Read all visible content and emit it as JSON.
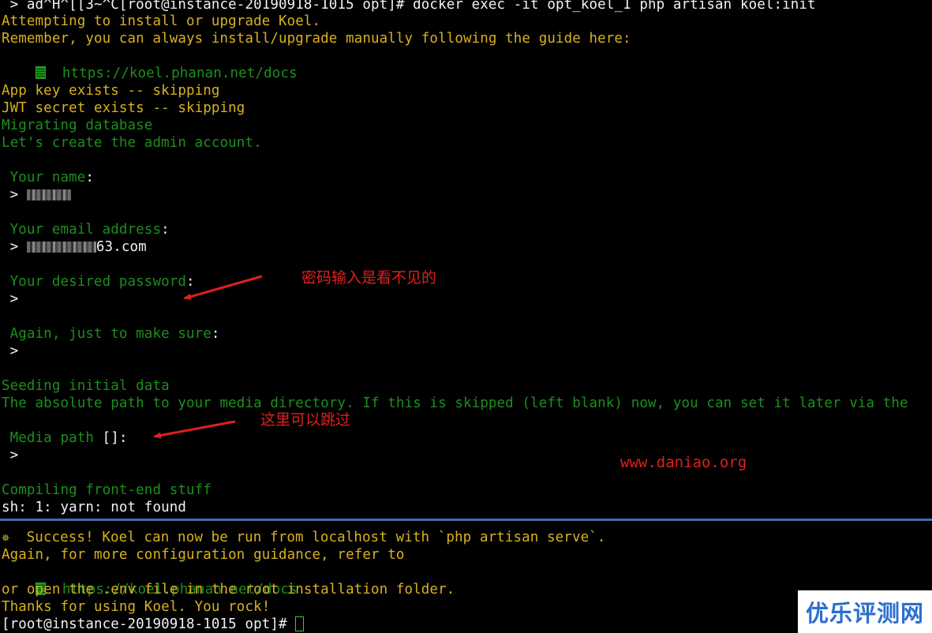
{
  "terminal": {
    "lines": {
      "cmd": " > ad^H^[[3~^C[root@instance-20190918-1015 opt]# docker exec -it opt_koel_1 php artisan koel:init",
      "attempting": "Attempting to install or upgrade Koel.",
      "remember": "Remember, you can always install/upgrade manually following the guide here:",
      "docs1": "  https://koel.phanan.net/docs",
      "appkey": "App key exists -- skipping",
      "jwt": "JWT secret exists -- skipping",
      "migrating": "Migrating database",
      "create_admin": "Let's create the admin account.",
      "name_prompt": " Your name",
      "colon": ":",
      "prompt_char": " > ",
      "email_prompt": " Your email address",
      "email_suffix": "63.com",
      "password_prompt": " Your desired password",
      "again_prompt": " Again, just to make sure",
      "seeding": "Seeding initial data",
      "absolute": "The absolute path to your media directory. If this is skipped (left blank) now, you can set it later via the",
      "media_prompt": " Media path ",
      "media_default": "[]:",
      "compiling": "Compiling front-end stuff",
      "yarn": "sh: 1: yarn: not found",
      "success": "  Success! Koel can now be run from localhost with `php artisan serve`.",
      "again_more": "Again, for more configuration guidance, refer to",
      "docs2": "  https://koel.phanan.net/docs",
      "env": "or open the .env file in the root installation folder.",
      "thanks": "Thanks for using Koel. You rock!",
      "final_prompt": "[root@instance-20190918-1015 opt]# "
    },
    "icons": {
      "doc_icon": "document-icon",
      "sparkle_icon": "sparkle-icon",
      "sparkle_glyph": "✵"
    },
    "colors": {
      "background": "#000000",
      "white": "#f2f2f2",
      "yellow": "#d9b11f",
      "green": "#1d8f1d",
      "annotation_red": "#e0201e",
      "divider_blue": "#3d6fa8"
    }
  },
  "annotations": {
    "password_note": "密码输入是看不见的",
    "media_note": "这里可以跳过"
  },
  "watermark": {
    "site": "www.daniao.org",
    "badge": "优乐评测网"
  }
}
